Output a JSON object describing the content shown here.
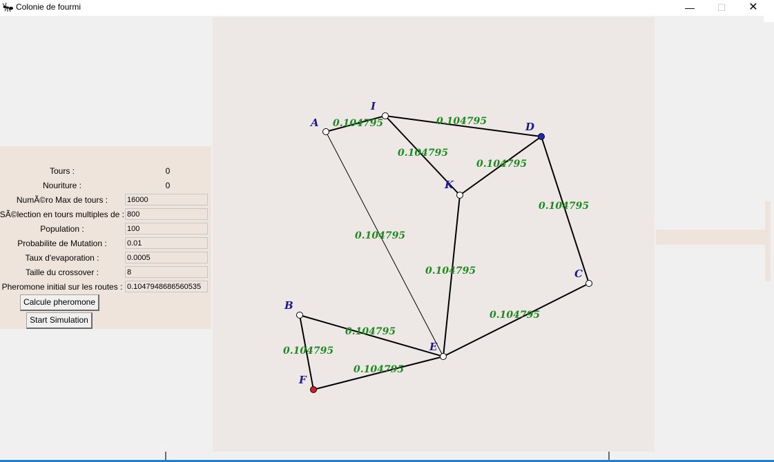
{
  "window": {
    "title": "Colonie de fourmi",
    "minimize_glyph": "—",
    "maximize_glyph": "☐",
    "close_glyph": "✕"
  },
  "stats": [
    {
      "label": "Tours :",
      "value": "0"
    },
    {
      "label": "Nouriture :",
      "value": "0"
    }
  ],
  "params": [
    {
      "label": "NumÃ©ro Max de tours :",
      "value": "16000"
    },
    {
      "label": "SÃ©lection en tours multiples de :",
      "value": "800"
    },
    {
      "label": "Population :",
      "value": "100"
    },
    {
      "label": "Probabilite de Mutation :",
      "value": "0.01"
    },
    {
      "label": "Taux d'evaporation :",
      "value": "0.0005"
    },
    {
      "label": "Taille du crossover :",
      "value": "8"
    },
    {
      "label": "Pheromone initial sur les routes :",
      "value": "0.1047948686560535"
    }
  ],
  "buttons": {
    "calcule": "Calcule pheromone",
    "start": "Start Simulation"
  },
  "graph": {
    "nodes": [
      {
        "id": "A",
        "label": "A",
        "kind": "normal"
      },
      {
        "id": "I",
        "label": "I",
        "kind": "normal"
      },
      {
        "id": "D",
        "label": "D",
        "kind": "destination"
      },
      {
        "id": "K",
        "label": "K",
        "kind": "normal"
      },
      {
        "id": "C",
        "label": "C",
        "kind": "normal"
      },
      {
        "id": "B",
        "label": "B",
        "kind": "normal"
      },
      {
        "id": "E",
        "label": "E",
        "kind": "normal"
      },
      {
        "id": "F",
        "label": "F",
        "kind": "source"
      }
    ],
    "edges": [
      {
        "from": "A",
        "to": "I",
        "pheromone": "0.104795",
        "bold": true
      },
      {
        "from": "I",
        "to": "D",
        "pheromone": "0.104795",
        "bold": true
      },
      {
        "from": "I",
        "to": "K",
        "pheromone": "0.104795",
        "bold": true
      },
      {
        "from": "D",
        "to": "K",
        "pheromone": "0.104795",
        "bold": true
      },
      {
        "from": "D",
        "to": "C",
        "pheromone": "0.104795",
        "bold": true
      },
      {
        "from": "A",
        "to": "E",
        "pheromone": "0.104795",
        "bold": false
      },
      {
        "from": "K",
        "to": "E",
        "pheromone": "0.104795",
        "bold": true
      },
      {
        "from": "C",
        "to": "E",
        "pheromone": "0.104795",
        "bold": true
      },
      {
        "from": "B",
        "to": "E",
        "pheromone": "0.104795",
        "bold": true
      },
      {
        "from": "B",
        "to": "F",
        "pheromone": "0.104795",
        "bold": true
      },
      {
        "from": "F",
        "to": "E",
        "pheromone": "0.104795",
        "bold": true
      }
    ],
    "colors": {
      "destination": "#1a28b4",
      "source": "#d42020",
      "normal": "#ffffff",
      "edge": "#000000",
      "edge_label": "#1f8a1f",
      "node_label": "#1a1a8c"
    }
  }
}
